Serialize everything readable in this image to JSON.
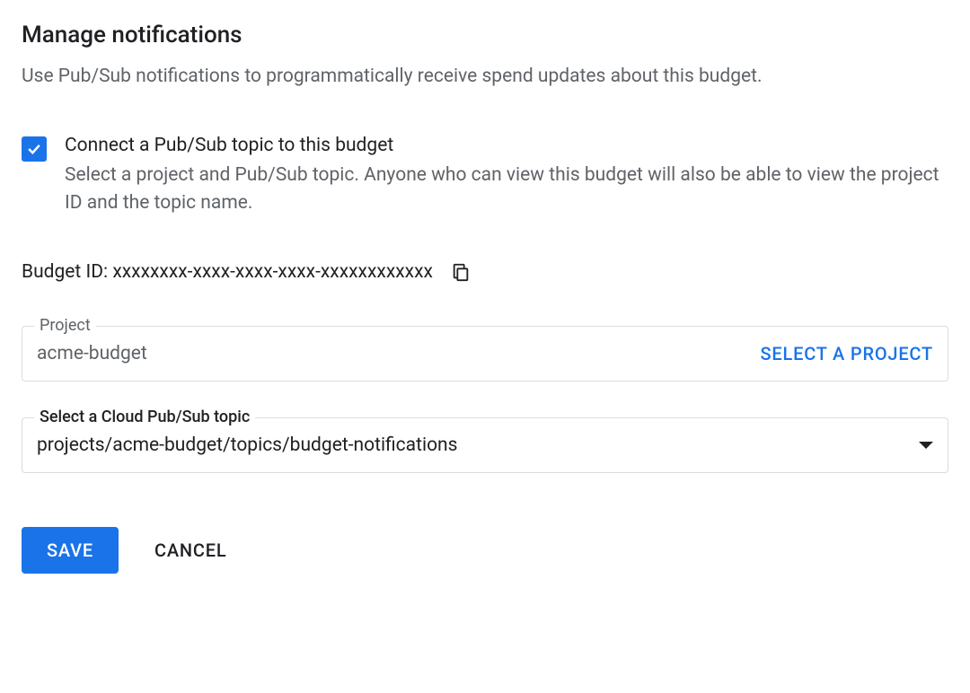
{
  "title": "Manage notifications",
  "description": "Use Pub/Sub notifications to programmatically receive spend updates about this budget.",
  "checkbox": {
    "label": "Connect a Pub/Sub topic to this budget",
    "description": "Select a project and Pub/Sub topic. Anyone who can view this budget will also be able to view the project ID and the topic name."
  },
  "budget_id": {
    "label": "Budget ID: ",
    "value": "xxxxxxxx-xxxx-xxxx-xxxx-xxxxxxxxxxxx"
  },
  "project_field": {
    "label": "Project",
    "value": "acme-budget",
    "button_label": "SELECT A PROJECT"
  },
  "topic_field": {
    "label": "Select a Cloud Pub/Sub topic",
    "value": "projects/acme-budget/topics/budget-notifications"
  },
  "buttons": {
    "save": "SAVE",
    "cancel": "CANCEL"
  }
}
